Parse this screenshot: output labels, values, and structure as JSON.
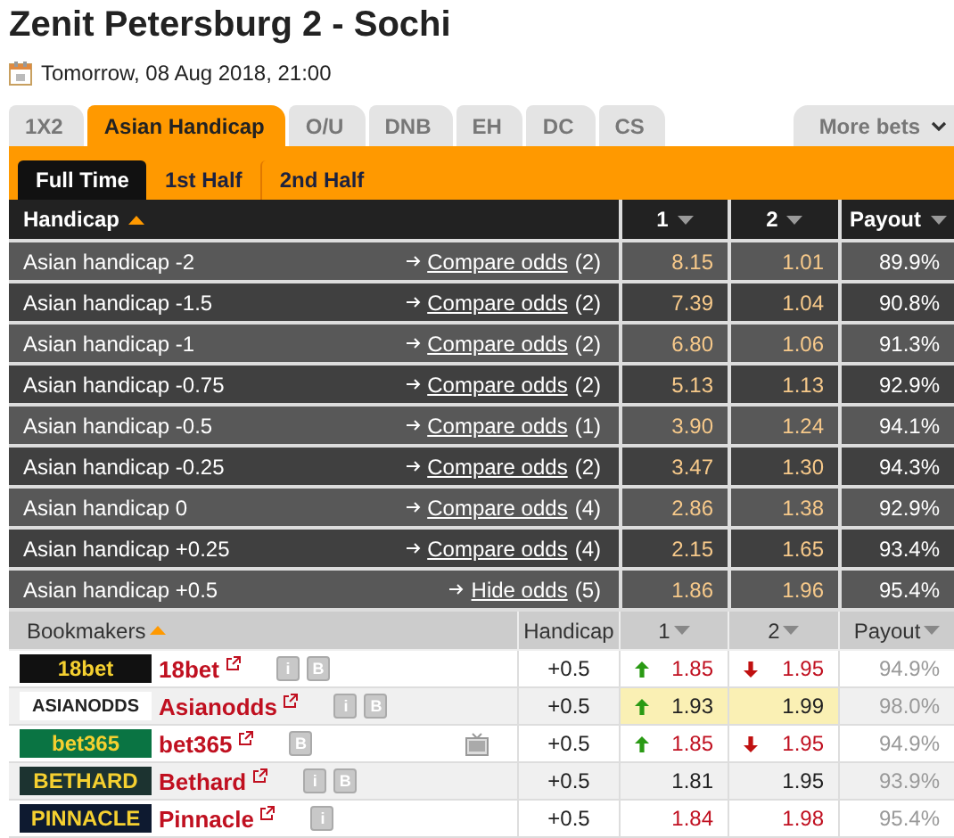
{
  "title": "Zenit Petersburg 2 - Sochi",
  "date": "Tomorrow, 08 Aug 2018, 21:00",
  "tabs": [
    {
      "label": "1X2",
      "selected": false
    },
    {
      "label": "Asian Handicap",
      "selected": true
    },
    {
      "label": "O/U",
      "selected": false
    },
    {
      "label": "DNB",
      "selected": false
    },
    {
      "label": "EH",
      "selected": false
    },
    {
      "label": "DC",
      "selected": false
    },
    {
      "label": "CS",
      "selected": false
    }
  ],
  "more_tab": {
    "label": "More bets"
  },
  "subtabs": [
    {
      "label": "Full Time",
      "selected": true
    },
    {
      "label": "1st Half",
      "selected": false
    },
    {
      "label": "2nd Half",
      "selected": false
    }
  ],
  "columns": [
    "Handicap",
    "1",
    "2",
    "Payout"
  ],
  "rows": [
    {
      "name": "Asian handicap -2",
      "link": "Compare odds",
      "count": "(2)",
      "odd1": "8.15",
      "odd2": "1.01",
      "payout": "89.9%"
    },
    {
      "name": "Asian handicap -1.5",
      "link": "Compare odds",
      "count": "(2)",
      "odd1": "7.39",
      "odd2": "1.04",
      "payout": "90.8%"
    },
    {
      "name": "Asian handicap -1",
      "link": "Compare odds",
      "count": "(2)",
      "odd1": "6.80",
      "odd2": "1.06",
      "payout": "91.3%"
    },
    {
      "name": "Asian handicap -0.75",
      "link": "Compare odds",
      "count": "(2)",
      "odd1": "5.13",
      "odd2": "1.13",
      "payout": "92.9%"
    },
    {
      "name": "Asian handicap -0.5",
      "link": "Compare odds",
      "count": "(1)",
      "odd1": "3.90",
      "odd2": "1.24",
      "payout": "94.1%"
    },
    {
      "name": "Asian handicap -0.25",
      "link": "Compare odds",
      "count": "(2)",
      "odd1": "3.47",
      "odd2": "1.30",
      "payout": "94.3%"
    },
    {
      "name": "Asian handicap 0",
      "link": "Compare odds",
      "count": "(4)",
      "odd1": "2.86",
      "odd2": "1.38",
      "payout": "92.9%"
    },
    {
      "name": "Asian handicap +0.25",
      "link": "Compare odds",
      "count": "(4)",
      "odd1": "2.15",
      "odd2": "1.65",
      "payout": "93.4%"
    },
    {
      "name": "Asian handicap +0.5",
      "link": "Hide odds",
      "count": "(5)",
      "odd1": "1.86",
      "odd2": "1.96",
      "payout": "95.4%"
    }
  ],
  "bookmaker_columns": [
    "Bookmakers",
    "Handicap",
    "1",
    "2",
    "Payout"
  ],
  "bookmakers": [
    {
      "logo": "18bet",
      "color": "#111111",
      "name": "18bet",
      "badges": [
        "i",
        "B"
      ],
      "tv": false,
      "handicap": "+0.5",
      "odds": [
        {
          "value": "1.85",
          "up": true,
          "down": false,
          "changed": true,
          "best": false
        },
        {
          "value": "1.95",
          "up": false,
          "down": true,
          "changed": true,
          "best": false
        }
      ],
      "payout": "94.9%"
    },
    {
      "logo": "ASIANODDS",
      "color": "#ffffff",
      "name": "Asianodds",
      "badges": [
        "i",
        "B"
      ],
      "tv": false,
      "handicap": "+0.5",
      "odds": [
        {
          "value": "1.93",
          "up": true,
          "down": false,
          "changed": false,
          "best": true
        },
        {
          "value": "1.99",
          "up": false,
          "down": false,
          "changed": false,
          "best": true
        }
      ],
      "payout": "98.0%"
    },
    {
      "logo": "bet365",
      "color": "#0a7443",
      "name": "bet365",
      "badges": [
        "B"
      ],
      "tv": true,
      "handicap": "+0.5",
      "odds": [
        {
          "value": "1.85",
          "up": true,
          "down": false,
          "changed": true,
          "best": false
        },
        {
          "value": "1.95",
          "up": false,
          "down": true,
          "changed": true,
          "best": false
        }
      ],
      "payout": "94.9%"
    },
    {
      "logo": "BETHARD",
      "color": "#1c3330",
      "name": "Bethard",
      "badges": [
        "i",
        "B"
      ],
      "tv": false,
      "handicap": "+0.5",
      "odds": [
        {
          "value": "1.81",
          "up": false,
          "down": false,
          "changed": false,
          "best": false
        },
        {
          "value": "1.95",
          "up": false,
          "down": false,
          "changed": false,
          "best": false
        }
      ],
      "payout": "93.9%"
    },
    {
      "logo": "PINNACLE",
      "color": "#0e1a30",
      "name": "Pinnacle",
      "badges": [
        "i"
      ],
      "tv": false,
      "handicap": "+0.5",
      "odds": [
        {
          "value": "1.84",
          "up": false,
          "down": false,
          "changed": true,
          "best": false
        },
        {
          "value": "1.98",
          "up": false,
          "down": false,
          "changed": true,
          "best": false
        }
      ],
      "payout": "95.4%"
    }
  ]
}
